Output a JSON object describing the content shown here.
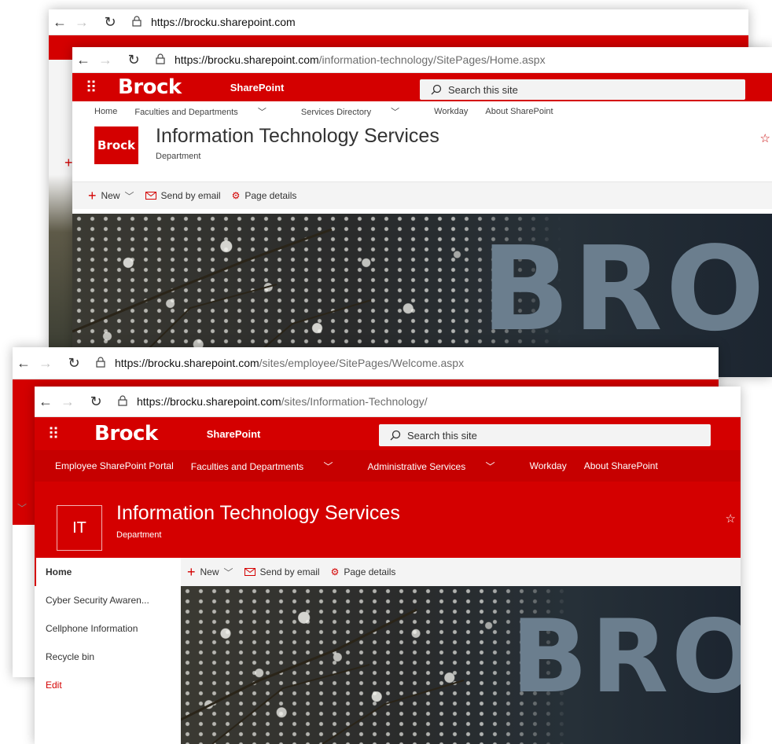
{
  "colors": {
    "brand": "#d40000",
    "text": "#333333"
  },
  "w1": {
    "url_host": "https://brocku.sharepoint.com",
    "url_path": ""
  },
  "w2": {
    "url_host": "https://brocku.sharepoint.com",
    "url_path": "/information-technology/SitePages/Home.aspx",
    "brand": "Brock",
    "app_name": "SharePoint",
    "search_placeholder": "Search this site",
    "hub_nav": [
      "Home",
      "Faculties and Departments",
      "Services Directory",
      "Workday",
      "About SharePoint"
    ],
    "site_logo": "Brock",
    "site_title": "Information Technology Services",
    "site_subtitle": "Department",
    "cmd_new": "New",
    "cmd_email": "Send by email",
    "cmd_details": "Page details",
    "hero_word": "BRO"
  },
  "w3": {
    "url_host": "https://brocku.sharepoint.com",
    "url_path": "/sites/employee/SitePages/Welcome.aspx"
  },
  "w4": {
    "url_host": "https://brocku.sharepoint.com",
    "url_path": "/sites/Information-Technology/",
    "brand": "Brock",
    "app_name": "SharePoint",
    "search_placeholder": "Search this site",
    "hub_nav": [
      "Employee SharePoint Portal",
      "Faculties and Departments",
      "Administrative Services",
      "Workday",
      "About SharePoint"
    ],
    "site_logo": "IT",
    "site_title": "Information Technology Services",
    "site_subtitle": "Department",
    "left_nav": [
      "Home",
      "Cyber Security Awaren...",
      "Cellphone Information",
      "Recycle bin",
      "Edit"
    ],
    "cmd_new": "New",
    "cmd_email": "Send by email",
    "cmd_details": "Page details",
    "hero_word": "BRO"
  }
}
